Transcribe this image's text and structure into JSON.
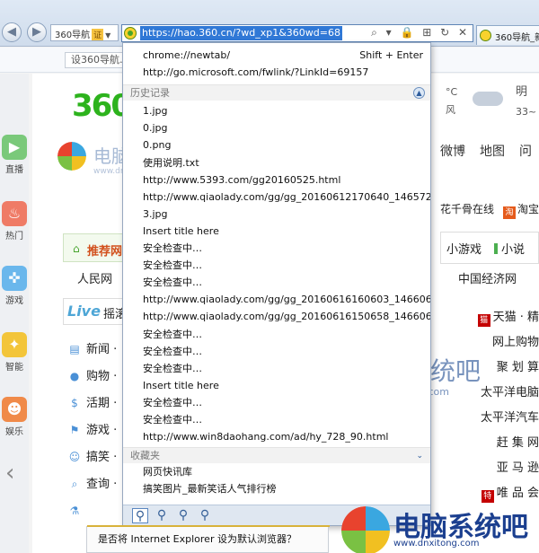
{
  "browser": {
    "site_name": "360导航",
    "cert_badge": "证",
    "url": "https://hao.360.cn/?wd_xp1&360wd=68",
    "tab_title": "360导航_新",
    "set_home": "设360导航…",
    "address_controls": "⌕ ▾ 🔒 ⊞ ↻ ✕"
  },
  "rail": [
    {
      "label": "直播",
      "icon": "video-icon",
      "color": "#7ac97a"
    },
    {
      "label": "热门",
      "icon": "flame-icon",
      "color": "#ef7b66"
    },
    {
      "label": "游戏",
      "icon": "gamepad-icon",
      "color": "#6ab7ec"
    },
    {
      "label": "智能",
      "icon": "bulb-icon",
      "color": "#f3c53a"
    },
    {
      "label": "娱乐",
      "icon": "emoji-icon",
      "color": "#f08a49"
    }
  ],
  "page": {
    "logo": "360",
    "weather": {
      "deg": "°C",
      "wind": "风",
      "day": "明",
      "temp": "33~"
    },
    "toplinks": [
      "微博",
      "地图",
      "问"
    ],
    "hotlinks": [
      {
        "icon_text": "",
        "text": "花千骨在线"
      },
      {
        "icon_text": "淘",
        "text": "淘宝"
      }
    ],
    "recommend_label": "推荐网",
    "renmin": "人民网",
    "live_logo": "Live",
    "live_text": "摇滚",
    "gamebox": {
      "a": "小游戏",
      "b": "小说"
    },
    "cnjj": "中国经济网",
    "categories": [
      {
        "icon": "▤",
        "name": "新闻 ·"
      },
      {
        "icon": "●",
        "name": "购物 ·"
      },
      {
        "icon": "$",
        "name": "活期 ·"
      },
      {
        "icon": "⚑",
        "name": "游戏 ·"
      },
      {
        "icon": "☺",
        "name": "搞笑 ·"
      },
      {
        "icon": "⌕",
        "name": "查询 ·"
      },
      {
        "icon": "⚗",
        "name": ""
      }
    ],
    "shops": [
      {
        "icon": "猫",
        "text": "天猫 · 精"
      },
      {
        "icon": "",
        "text": "网上购物"
      },
      {
        "icon": "",
        "text": "聚 划 算"
      },
      {
        "icon": "",
        "text": "太平洋电脑"
      },
      {
        "icon": "",
        "text": "太平洋汽车"
      },
      {
        "icon": "",
        "text": "赶 集 网"
      },
      {
        "icon": "",
        "text": "亚 马 逊"
      },
      {
        "icon": "特",
        "text": "唯 品 会"
      }
    ]
  },
  "dropdown": {
    "suggestions": [
      {
        "text": "chrome://newtab/",
        "shortcut": "Shift + Enter"
      },
      {
        "text": "http://go.microsoft.com/fwlink/?LinkId=69157",
        "shortcut": ""
      }
    ],
    "history_header": "历史记录",
    "history": [
      "1.jpg",
      "0.jpg",
      "0.png",
      "使用说明.txt",
      "http://www.5393.com/gg20160525.html",
      "http://www.qiaolady.com/gg/gg_20160612170640_146572...",
      "3.jpg",
      "Insert title here",
      "安全检查中…",
      "安全检查中…",
      "安全检查中…",
      "http://www.qiaolady.com/gg/gg_20160616160603_146606...",
      "http://www.qiaolady.com/gg/gg_20160616150658_146606...",
      "安全检查中…",
      "安全检查中…",
      "安全检查中…",
      "Insert title here",
      "安全检查中…",
      "安全检查中…",
      "http://www.win8daohang.com/ad/hy_728_90.html"
    ],
    "favorites_header": "收藏夹",
    "favorites": [
      "网页快讯库",
      "搞笑图片_最新笑话人气排行榜"
    ]
  },
  "notification": "是否将 Internet Explorer 设为默认浏览器？",
  "watermark": {
    "title": "电脑系统吧",
    "url": "www.dnxitong.com"
  }
}
